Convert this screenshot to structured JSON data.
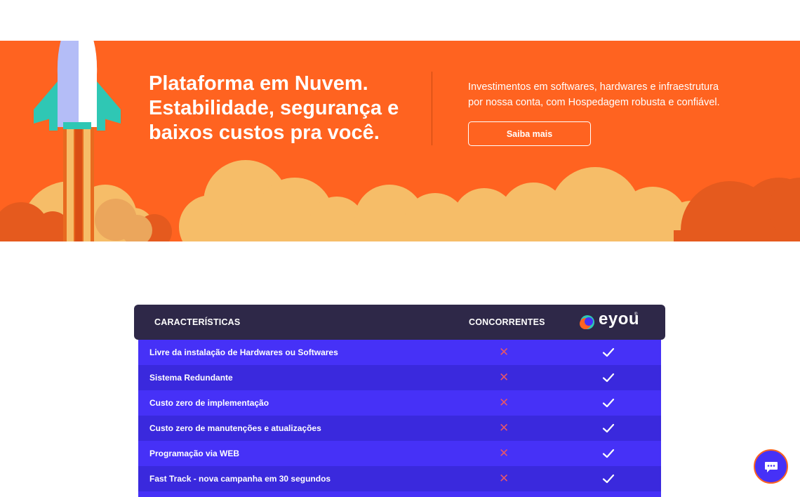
{
  "hero": {
    "title_lines": [
      "Plataforma em Nuvem.",
      "Estabilidade, segurança e",
      "baixos custos pra você."
    ],
    "description_lines": [
      "Investimentos em softwares, hardwares e infraestrutura",
      "por nossa conta, com Hospedagem robusta e confiável."
    ],
    "cta_label": "Saiba mais"
  },
  "comparison": {
    "headers": {
      "feature": "CARACTERÍSTICAS",
      "competitors": "CONCORRENTES",
      "brand": "eyou"
    },
    "rows": [
      {
        "feature": "Livre da instalação de Hardwares ou Softwares",
        "competitors": "✕",
        "brand": "check-icon"
      },
      {
        "feature": "Sistema Redundante",
        "competitors": "✕",
        "brand": "check-icon"
      },
      {
        "feature": "Custo zero de implementação",
        "competitors": "✕",
        "brand": "check-icon"
      },
      {
        "feature": "Custo zero de manutenções e atualizações",
        "competitors": "✕",
        "brand": "check-icon"
      },
      {
        "feature": "Programação via WEB",
        "competitors": "✕",
        "brand": "check-icon"
      },
      {
        "feature": "Fast Track - nova campanha em 30 segundos",
        "competitors": "✕",
        "brand": "check-icon"
      }
    ]
  },
  "colors": {
    "hero_orange": "#ff6320",
    "cloud_light": "#f6bd68",
    "cloud_dark": "#e55a1e",
    "table_header": "#2e2848",
    "row_primary": "#4631f7",
    "row_alt": "#3a29dd",
    "cross": "#e5566a"
  },
  "icons": {
    "rocket": "rocket-illustration",
    "cross": "cross-icon",
    "check": "check-icon",
    "chat": "chat-bubble-icon",
    "logo": "eyou-logo"
  }
}
